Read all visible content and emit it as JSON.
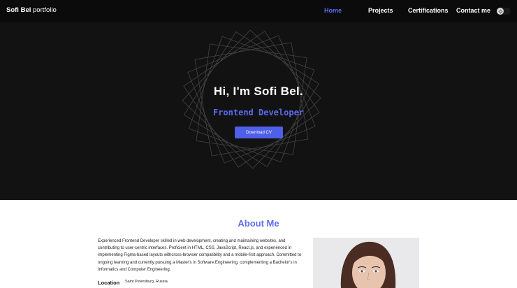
{
  "header": {
    "logo_bold": "Sofi Bel",
    "logo_light": "portfolio",
    "nav": [
      {
        "label": "Home",
        "active": true
      },
      {
        "label": "Projects",
        "active": false
      },
      {
        "label": "Certifications",
        "active": false
      },
      {
        "label": "Contact me",
        "active": false
      }
    ],
    "theme_toggle_icon": "sun-icon"
  },
  "hero": {
    "title": "Hi, I'm Sofi Bel.",
    "role": "Frontend Developer",
    "cv_button": "Download CV"
  },
  "about": {
    "title": "About Me",
    "text": "Experienced Frontend Developer skilled in web development, creating and maintaining websites, and contributing to user-centric interfaces. Proficient in HTML, CSS, JavaScript, React.js, and experienced in implementing Figma-based layouts withcross-browser compatibility and a mobile-first approach. Committed to ongoing learning and currently pursuing a Master's in Software Engineering, complementing a Bachelor's in Informatics and Computer Engineering.",
    "location_label": "Location",
    "location_value": "Saint Petersburg, Russia"
  },
  "colors": {
    "accent": "#5b6cf0",
    "button": "#4f5fe8",
    "header_bg": "#0b0b0b",
    "hero_bg": "#121212"
  }
}
